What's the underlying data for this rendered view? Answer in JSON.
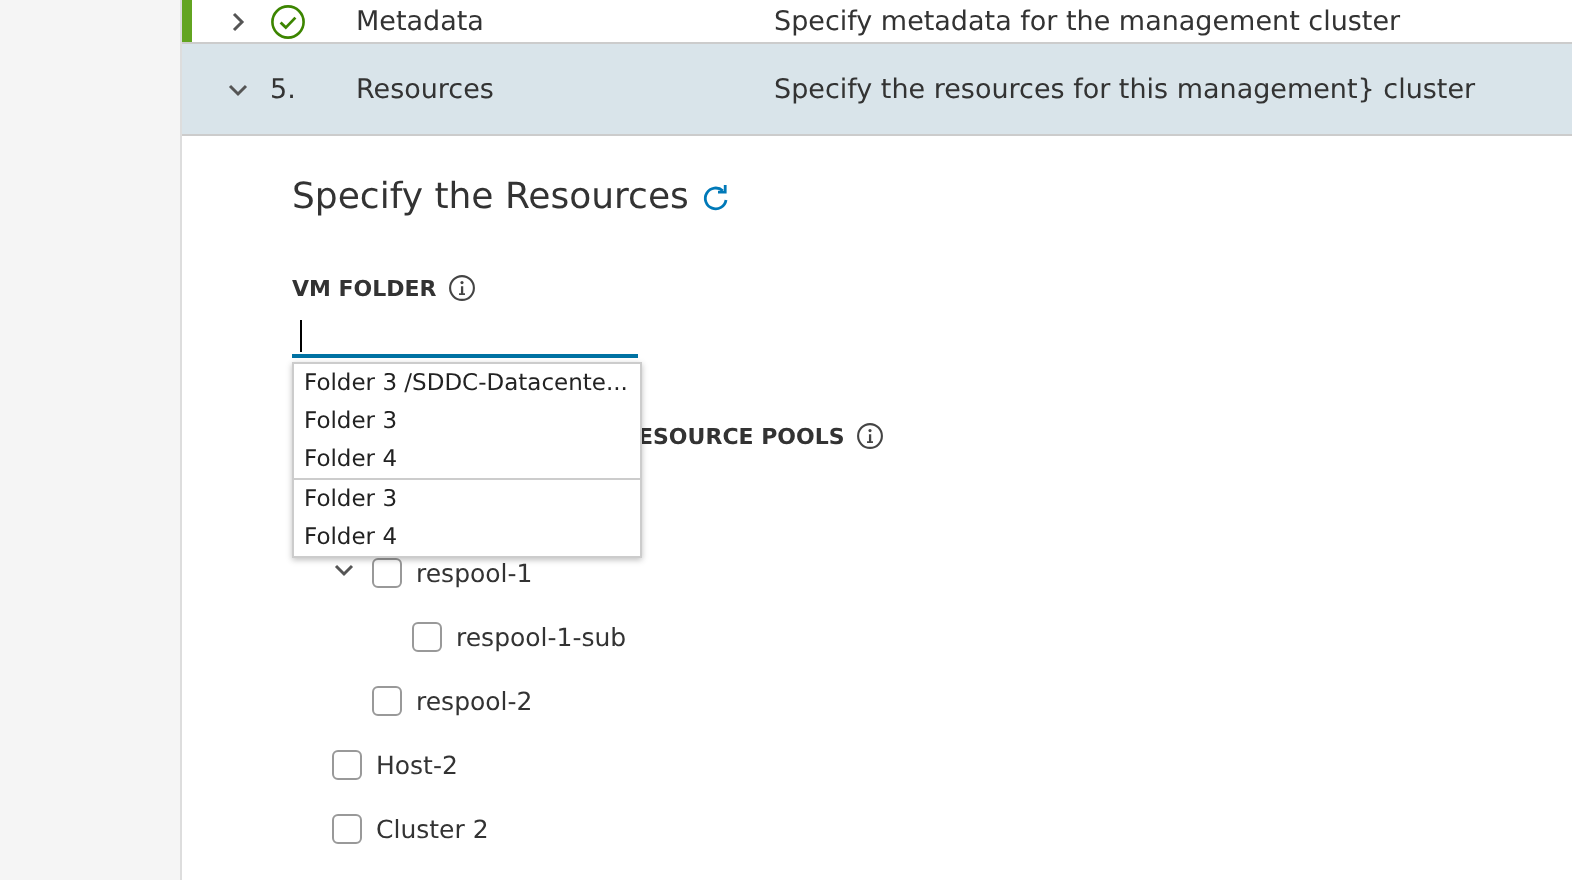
{
  "steps": [
    {
      "kind": "done",
      "title": "Metadata",
      "description": "Specify metadata for the management cluster",
      "expanded": false,
      "selected": false
    },
    {
      "kind": "number",
      "number": "5.",
      "title": "Resources",
      "description": "Specify the resources for this management} cluster",
      "expanded": true,
      "selected": true
    }
  ],
  "content": {
    "title": "Specify the Resources",
    "vm_folder": {
      "label": "VM FOLDER",
      "dropdown_groups": [
        [
          "Folder 3 /SDDC-Datacente...",
          "Folder 3",
          "Folder 4"
        ],
        [
          "Folder 3",
          "Folder 4"
        ]
      ]
    },
    "resource_pools_label": "ESOURCE POOLS",
    "tree": [
      {
        "children": [
          {
            "label": "respool-1",
            "checked": false,
            "expanded": true,
            "children": [
              {
                "label": "respool-1-sub",
                "checked": false
              }
            ]
          },
          {
            "label": "respool-2",
            "checked": false
          }
        ]
      },
      {
        "label": "Host-2",
        "checked": false
      },
      {
        "label": "Cluster 2",
        "checked": false
      }
    ]
  }
}
